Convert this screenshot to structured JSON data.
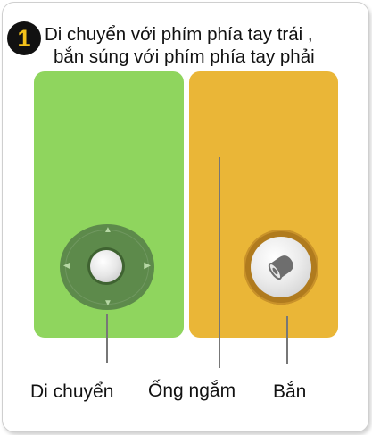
{
  "step": {
    "number": "1"
  },
  "title": {
    "line1": "Di chuyển với phím phía tay trái ,",
    "line2": "bắn súng với phím phía tay phải"
  },
  "labels": {
    "move": "Di chuyển",
    "aim": "Ống ngắm",
    "shoot": "Bắn"
  },
  "controls": {
    "dpad_icon": "dpad-icon",
    "fire_icon": "bullet-icon"
  },
  "colors": {
    "move_zone": "#8fd55e",
    "aim_zone": "#eab637",
    "badge_number": "#f4c21a"
  }
}
